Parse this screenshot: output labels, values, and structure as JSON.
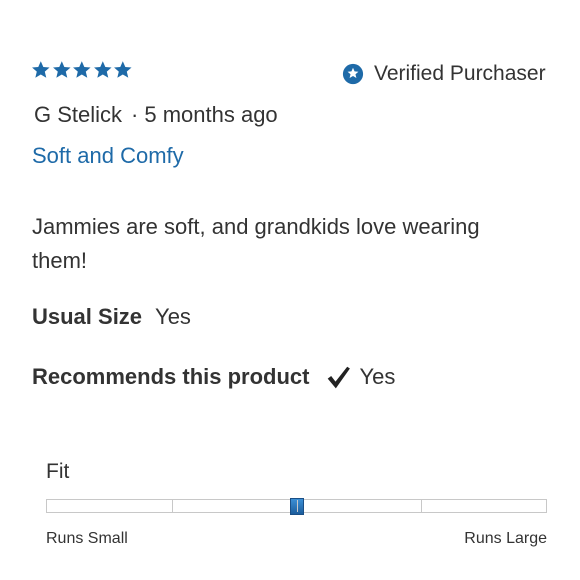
{
  "rating": {
    "value": 5,
    "max": 5,
    "star_color": "#1e6aa8"
  },
  "verified": {
    "label": "Verified Purchaser",
    "icon": "star-badge-icon",
    "icon_color": "#1e6aa8"
  },
  "meta": {
    "author": "G Stelick",
    "separator": "·",
    "time": "5 months ago"
  },
  "review": {
    "title": "Soft and Comfy",
    "title_color": "#1e6aa8",
    "body": "Jammies are soft, and grandkids love wearing them!"
  },
  "attributes": {
    "usual_size": {
      "label": "Usual Size",
      "value": "Yes"
    },
    "recommends": {
      "label": "Recommends this product",
      "value": "Yes",
      "icon": "checkmark-icon"
    }
  },
  "fit": {
    "label": "Fit",
    "min_label": "Runs Small",
    "max_label": "Runs Large",
    "value_fraction": 0.5,
    "segments": 4
  }
}
